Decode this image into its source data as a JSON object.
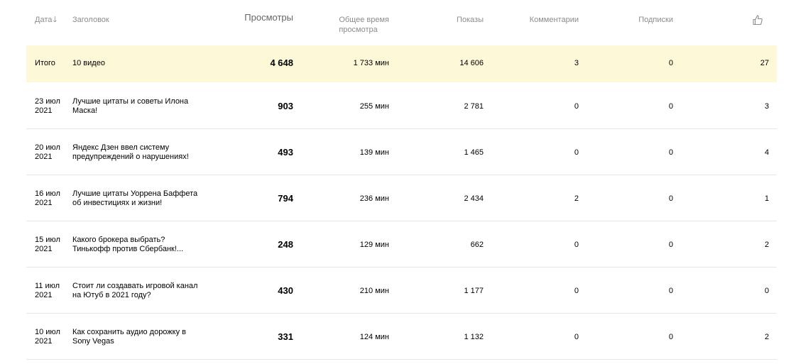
{
  "header": {
    "date": "Дата",
    "sort_icon": "arrow-down-icon",
    "title": "Заголовок",
    "views": "Просмотры",
    "time_line1": "Общее время",
    "time_line2": "просмотра",
    "shows": "Показы",
    "comments": "Комментарии",
    "subscriptions": "Подписки",
    "likes_icon": "thumbs-up-icon"
  },
  "total": {
    "label": "Итого",
    "title": "10 видео",
    "views": "4 648",
    "time": "1 733 мин",
    "shows": "14 606",
    "comments": "3",
    "subscriptions": "0",
    "likes": "27"
  },
  "rows": [
    {
      "date_line1": "23 июл",
      "date_line2": "2021",
      "title_line1": "Лучшие цитаты и советы Илона",
      "title_line2": "Маска!",
      "views": "903",
      "time": "255 мин",
      "shows": "2 781",
      "comments": "0",
      "subscriptions": "0",
      "likes": "3"
    },
    {
      "date_line1": "20 июл",
      "date_line2": "2021",
      "title_line1": "Яндекс Дзен ввел систему",
      "title_line2": "предупреждений о нарушениях!",
      "views": "493",
      "time": "139 мин",
      "shows": "1 465",
      "comments": "0",
      "subscriptions": "0",
      "likes": "4"
    },
    {
      "date_line1": "16 июл",
      "date_line2": "2021",
      "title_line1": "Лучшие цитаты Уоррена Баффета",
      "title_line2": "об инвестициях и жизни!",
      "views": "794",
      "time": "236 мин",
      "shows": "2 434",
      "comments": "2",
      "subscriptions": "0",
      "likes": "1"
    },
    {
      "date_line1": "15 июл",
      "date_line2": "2021",
      "title_line1": "Какого брокера выбрать?",
      "title_line2": "Тинькофф против Сбербанк!...",
      "views": "248",
      "time": "129 мин",
      "shows": "662",
      "comments": "0",
      "subscriptions": "0",
      "likes": "2"
    },
    {
      "date_line1": "11 июл",
      "date_line2": "2021",
      "title_line1": "Стоит ли создавать игровой канал",
      "title_line2": "на Ютуб в 2021 году?",
      "views": "430",
      "time": "210 мин",
      "shows": "1 177",
      "comments": "0",
      "subscriptions": "0",
      "likes": "0"
    },
    {
      "date_line1": "10 июл",
      "date_line2": "2021",
      "title_line1": "Как сохранить аудио дорожку в",
      "title_line2": "Sony Vegas",
      "views": "331",
      "time": "124 мин",
      "shows": "1 132",
      "comments": "0",
      "subscriptions": "0",
      "likes": "2"
    }
  ]
}
